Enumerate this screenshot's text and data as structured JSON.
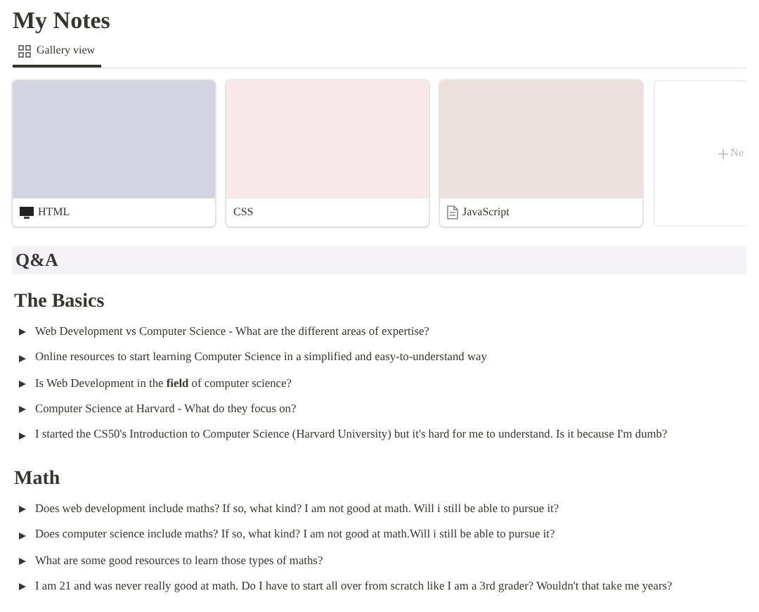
{
  "page_title": "My Notes",
  "tabs": [
    {
      "label": "Gallery view",
      "selected": true
    }
  ],
  "gallery": [
    {
      "title": "HTML",
      "kind": "monitor",
      "color": "#d4d3e2"
    },
    {
      "title": "CSS",
      "kind": "plain",
      "color": "#f8e8ea"
    },
    {
      "title": "JavaScript",
      "kind": "document",
      "color": "#ede1df"
    }
  ],
  "new_card": {
    "label": "Ne"
  },
  "banner": "Q&A",
  "sections": [
    {
      "heading": "The Basics",
      "items": [
        {
          "text": "Web Development vs Computer Science - What are the different areas of expertise?",
          "expanded": false
        },
        {
          "text": "Online resources to start learning Computer Science in a simplified and easy-to-understand way",
          "expanded": false
        },
        {
          "text": "Is Web Development in the **field** of computer science?",
          "expanded": false
        },
        {
          "text": "Computer Science at Harvard - What do they focus on?",
          "expanded": false
        },
        {
          "text": "I started the CS50's Introduction to Computer Science (Harvard University) but it's hard for me to understand. Is it because I'm dumb?",
          "expanded": false
        }
      ]
    },
    {
      "heading": "Math",
      "items": [
        {
          "text": "Does web development include maths? If so, what kind? I am not good at math. Will i still be able to pursue it?",
          "expanded": false
        },
        {
          "text": "Does computer science include maths? If so, what kind? I am not good at math.Will i still be able to pursue it?",
          "expanded": false
        },
        {
          "text": "What are some good resources to learn those types of maths?",
          "expanded": false
        },
        {
          "text": "I am 21 and was never really good at math. Do I have to start all over from scratch like I am a 3rd grader? Wouldn't that take me years?",
          "expanded": false
        }
      ]
    }
  ]
}
